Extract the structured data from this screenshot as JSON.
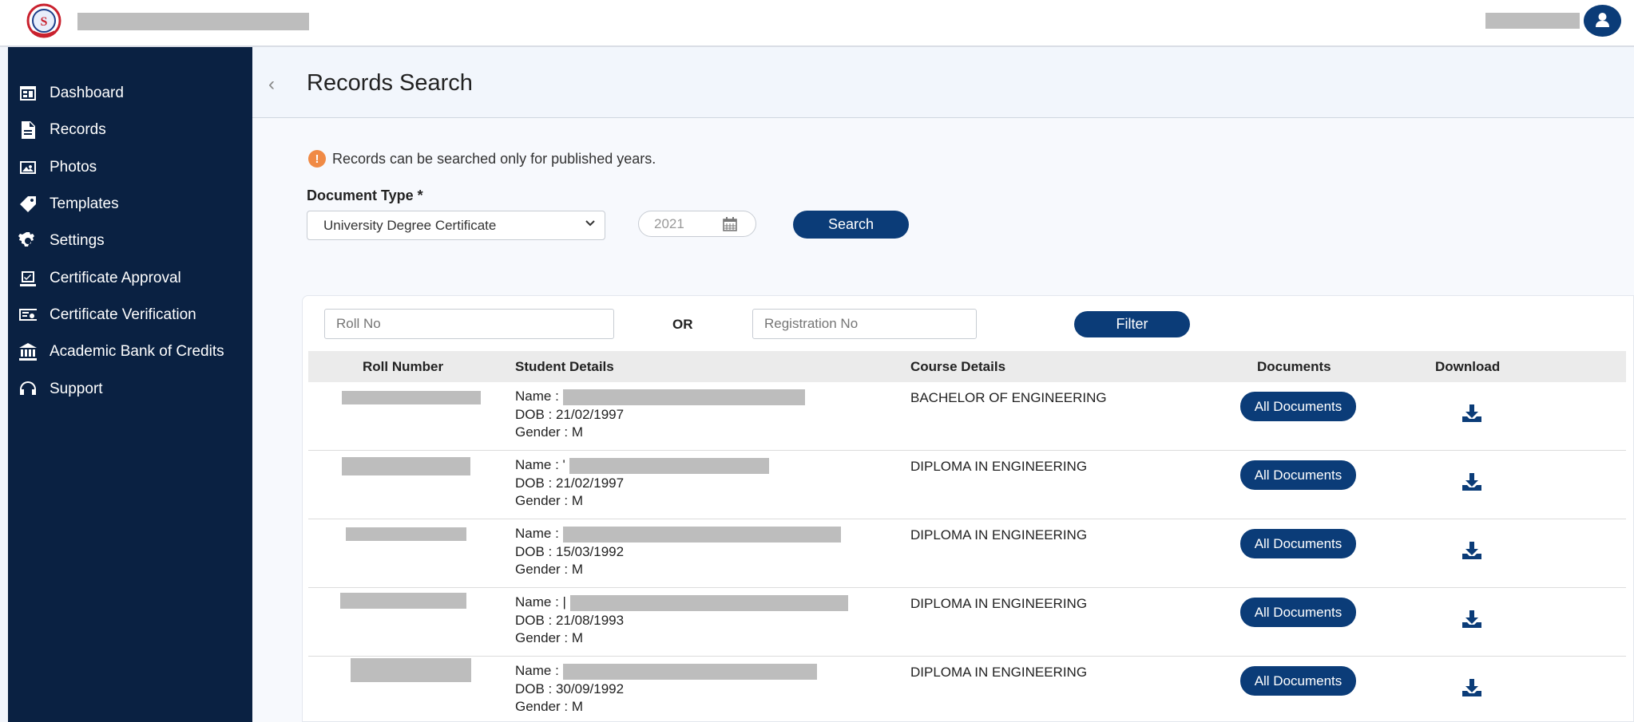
{
  "app": {
    "logo_text": "S"
  },
  "sidebar": {
    "items": [
      {
        "label": "Dashboard",
        "icon": "dashboard-icon"
      },
      {
        "label": "Records",
        "icon": "file-icon"
      },
      {
        "label": "Photos",
        "icon": "photos-icon"
      },
      {
        "label": "Templates",
        "icon": "tag-icon"
      },
      {
        "label": "Settings",
        "icon": "gear-icon"
      },
      {
        "label": "Certificate Approval",
        "icon": "approval-icon"
      },
      {
        "label": "Certificate Verification",
        "icon": "verification-icon"
      },
      {
        "label": "Academic Bank of Credits",
        "icon": "bank-icon"
      },
      {
        "label": "Support",
        "icon": "headset-icon"
      }
    ]
  },
  "page": {
    "title": "Records Search",
    "back": "‹"
  },
  "notice": {
    "icon": "!",
    "text": "Records can be searched only for published years."
  },
  "form": {
    "doc_type_label": "Document Type *",
    "doc_type_value": "University Degree Certificate",
    "year": "2021",
    "search_label": "Search"
  },
  "filter": {
    "roll_placeholder": "Roll No",
    "or_label": "OR",
    "reg_placeholder": "Registration No",
    "filter_label": "Filter"
  },
  "table": {
    "headers": [
      "Roll Number",
      "Student Details",
      "Course Details",
      "Documents",
      "Download"
    ],
    "rows": [
      {
        "name_label": "Name :",
        "dob": "DOB : 21/02/1997",
        "gender": "Gender : M",
        "course": "BACHELOR OF ENGINEERING",
        "docs_label": "All Documents"
      },
      {
        "name_label": "Name : '",
        "dob": "DOB : 21/02/1997",
        "gender": "Gender : M",
        "course": "DIPLOMA IN ENGINEERING",
        "docs_label": "All Documents"
      },
      {
        "name_label": "Name :",
        "dob": "DOB : 15/03/1992",
        "gender": "Gender : M",
        "course": "DIPLOMA IN ENGINEERING",
        "docs_label": "All Documents"
      },
      {
        "name_label": "Name : |",
        "dob": "DOB : 21/08/1993",
        "gender": "Gender : M",
        "course": "DIPLOMA IN ENGINEERING",
        "docs_label": "All Documents"
      },
      {
        "name_label": "Name :",
        "dob": "DOB : 30/09/1992",
        "gender": "Gender : M",
        "course": "DIPLOMA IN ENGINEERING",
        "docs_label": "All Documents"
      }
    ]
  },
  "colors": {
    "sidebar": "#0a2142",
    "primary": "#0b3c78",
    "notice": "#f08a45"
  }
}
